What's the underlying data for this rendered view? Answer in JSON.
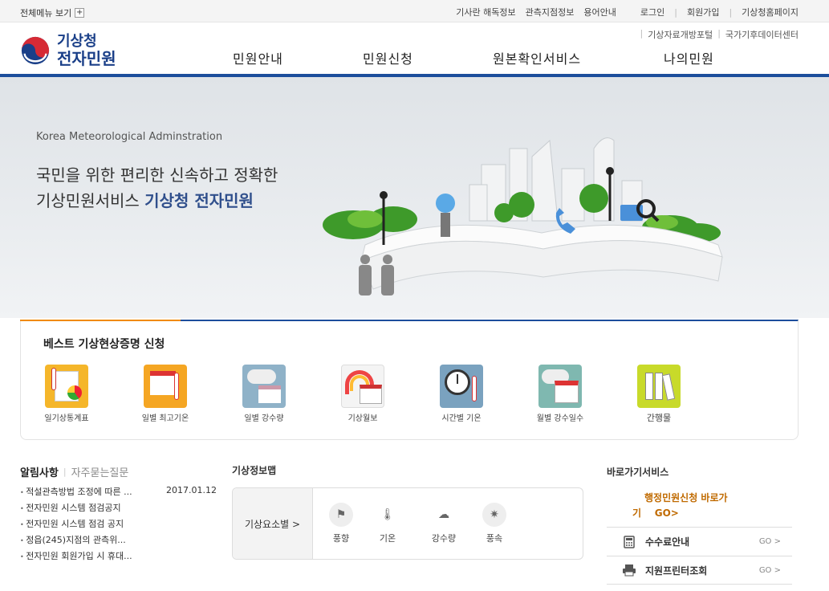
{
  "util": {
    "all_menu": "전체메뉴 보기",
    "plus": "+",
    "links": [
      "기사란 해독정보",
      "관측지점정보",
      "용어안내"
    ],
    "auth": [
      "로그인",
      "회원가입",
      "기상청홈페이지"
    ],
    "links2": [
      "기상자료개방포털",
      "국가기후데이터센터"
    ]
  },
  "logo": {
    "line1": "기상청",
    "line2": "전자민원"
  },
  "gnb": [
    "민원안내",
    "민원신청",
    "원본확인서비스",
    "나의민원"
  ],
  "hero": {
    "en": "Korea Meteorological Adminstration",
    "line1": "국민을 위한 편리한 신속하고 정확한",
    "line2_plain": "기상민원서비스 ",
    "line2_bold": "기상청 전자민원"
  },
  "best": {
    "title": "베스트 기상현상증명 신청",
    "items": [
      "일기상통계표",
      "일별 최고기온",
      "일별 강수량",
      "기상월보",
      "시간별 기온",
      "월별 강수일수",
      "간행물"
    ]
  },
  "notice": {
    "tab_active": "알림사항",
    "tab_inactive": "자주묻는질문",
    "rows": [
      {
        "title": "적설관측방법 조정에 따른 ...",
        "date": "2017.01.12"
      },
      {
        "title": "전자민원 시스템 점검공지",
        "date": ""
      },
      {
        "title": "전자민원 시스템 점검 공지",
        "date": ""
      },
      {
        "title": "정읍(245)지점의 관측위...",
        "date": ""
      },
      {
        "title": "전자민원 회원가입 시 휴대...",
        "date": ""
      }
    ]
  },
  "weather_map": {
    "title": "기상정보맵",
    "selector": "기상요소별 >",
    "items": [
      "풍향",
      "기온",
      "강수량",
      "풍속"
    ]
  },
  "shortcut": {
    "title": "바로가기서비스",
    "featured_line1": "행정민원신청 바로가",
    "featured_line2": "기    GO>",
    "rows": [
      {
        "name": "수수료안내",
        "go": "GO >",
        "icon": "calculator-icon"
      },
      {
        "name": "지원프린터조회",
        "go": "GO >",
        "icon": "printer-icon"
      }
    ]
  },
  "colors": {
    "brand": "#1c4e9c",
    "accent": "#f08a00",
    "go": "#c06a00"
  }
}
